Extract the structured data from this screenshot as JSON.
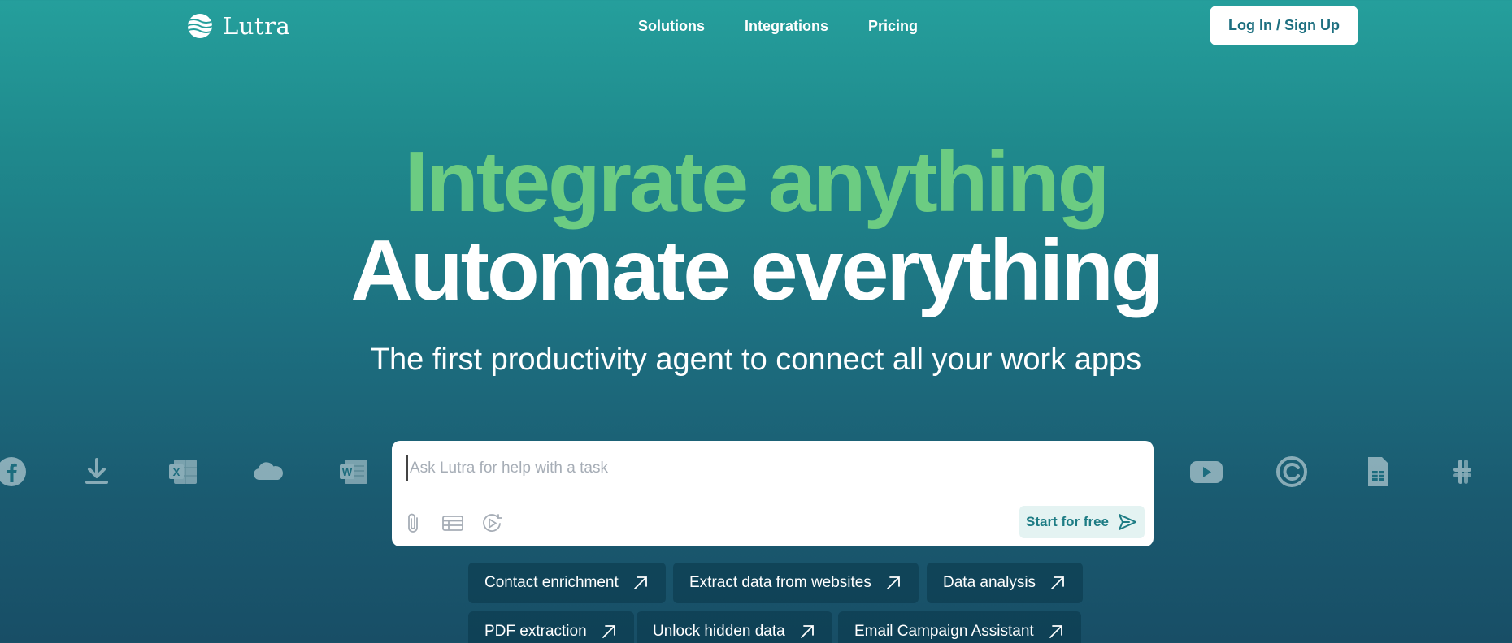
{
  "nav": {
    "logo_text": "Lutra",
    "links": [
      "Solutions",
      "Integrations",
      "Pricing"
    ],
    "login_label": "Log In / Sign Up"
  },
  "hero": {
    "line1": "Integrate anything",
    "line2": "Automate everything",
    "subtitle": "The first productivity agent to connect all your work apps"
  },
  "prompt": {
    "placeholder": "Ask Lutra for help with a task",
    "start_label": "Start for free"
  },
  "chips": [
    "Contact enrichment",
    "Extract data from websites",
    "Data analysis",
    "PDF extraction",
    "Unlock hidden data",
    "Email Campaign Assistant"
  ],
  "app_icons_left": [
    "facebook-icon",
    "download-icon",
    "excel-icon",
    "onedrive-icon",
    "word-icon"
  ],
  "app_icons_right": [
    "youtube-icon",
    "coda-icon",
    "google-sheets-icon",
    "slack-icon"
  ],
  "colors": {
    "headline_green": "#6ccc82",
    "bg_top": "#259f9c",
    "bg_bottom": "#184e66",
    "accent_teal": "#1d7c84"
  }
}
